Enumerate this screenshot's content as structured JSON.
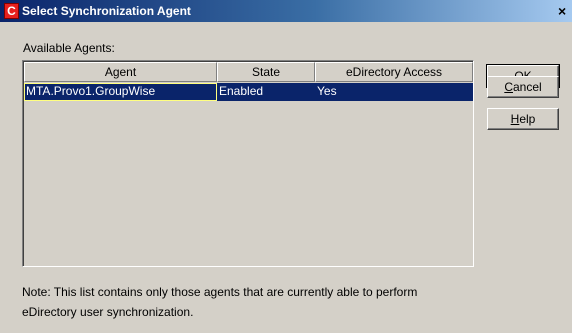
{
  "window": {
    "title": "Select Synchronization Agent",
    "icon_glyph": "C",
    "close_glyph": "×"
  },
  "available_label": "Available Agents:",
  "table": {
    "columns": [
      "Agent",
      "State",
      "eDirectory Access"
    ],
    "rows": [
      {
        "agent": "MTA.Provo1.GroupWise",
        "state": "Enabled",
        "access": "Yes",
        "selected": true
      }
    ]
  },
  "note": {
    "line1": "Note: This list contains only those agents that are currently able to perform",
    "line2": "eDirectory user synchronization."
  },
  "buttons": {
    "ok": {
      "pre": "O",
      "mnemonic": "K",
      "post": ""
    },
    "cancel": {
      "pre": "",
      "mnemonic": "C",
      "post": "ancel"
    },
    "help": {
      "pre": "",
      "mnemonic": "H",
      "post": "elp"
    }
  },
  "colors": {
    "dialog_bg": "#d4d0c8",
    "title_bar_start": "#0a246a",
    "selection": "#0a246a",
    "icon_red": "#e8201e"
  }
}
